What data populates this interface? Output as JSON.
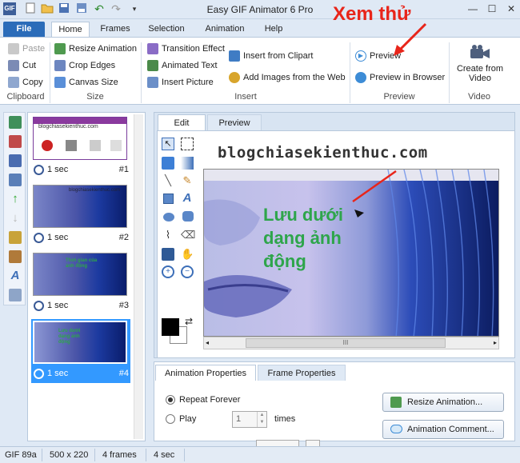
{
  "window": {
    "title": "Easy GIF Animator 6 Pro",
    "controls": [
      "minimize-icon",
      "maximize-icon",
      "close-icon"
    ]
  },
  "quick_access": [
    "app-gif-icon",
    "new-icon",
    "open-icon",
    "save-icon",
    "save-all-icon",
    "undo-icon",
    "redo-icon",
    "customize-icon"
  ],
  "annotation": {
    "label": "Xem thử",
    "color": "#e8251a"
  },
  "ribbon": {
    "tabs": [
      "File",
      "Home",
      "Frames",
      "Selection",
      "Animation",
      "Help"
    ],
    "active_tab": "Home",
    "clipboard": {
      "paste": "Paste",
      "cut": "Cut",
      "copy": "Copy",
      "group": "Clipboard"
    },
    "size": {
      "resize": "Resize Animation",
      "crop": "Crop Edges",
      "canvas": "Canvas Size",
      "group": "Size"
    },
    "insert": {
      "transition": "Transition Effect",
      "animated_text": "Animated Text",
      "insert_picture": "Insert Picture",
      "clipart": "Insert from Clipart",
      "web": "Add Images from the Web",
      "group": "Insert"
    },
    "preview": {
      "preview": "Preview",
      "browser": "Preview in Browser",
      "group": "Preview"
    },
    "video": {
      "create": "Create from Video",
      "group": "Video"
    }
  },
  "frames": [
    {
      "duration": "1 sec",
      "number": "#1",
      "thumb_text": "blogchiasekienthuc.com"
    },
    {
      "duration": "1 sec",
      "number": "#2",
      "thumb_text": "blogchiasekienthuc.com"
    },
    {
      "duration": "1 sec",
      "number": "#3",
      "thumb_text": "Thời gian của ảnh động"
    },
    {
      "duration": "1 sec",
      "number": "#4",
      "thumb_text": "Lưu dưới dạng ảnh động",
      "selected": true
    }
  ],
  "editor": {
    "tabs": [
      "Edit",
      "Preview"
    ],
    "active_tab": "Edit",
    "watermark": "blogchiasekienthuc.com",
    "canvas_text": "Lưu dưới dạng ảnh động",
    "canvas_text_color": "#2ea54b",
    "hscroll_mark": "III"
  },
  "properties": {
    "tabs": [
      "Animation Properties",
      "Frame Properties"
    ],
    "repeat_forever": "Repeat Forever",
    "play": "Play",
    "play_count": "1",
    "times": "times",
    "resize_btn": "Resize Animation...",
    "comment_btn": "Animation Comment..."
  },
  "statusbar": [
    "GIF 89a",
    "500 x 220",
    "4 frames",
    "4 sec"
  ],
  "colors": {
    "accent": "#2b6cb9",
    "selection": "#3399ff",
    "annotation_red": "#e8251a"
  }
}
